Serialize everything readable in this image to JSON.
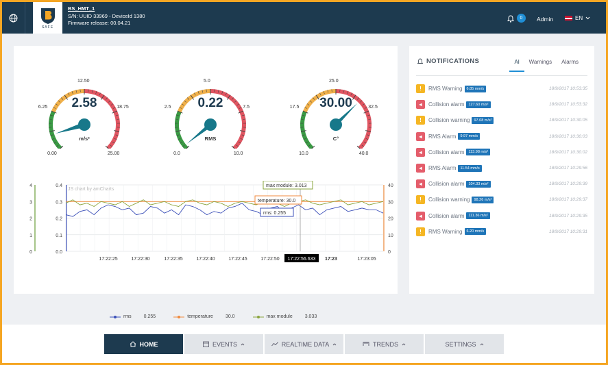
{
  "header": {
    "device_name": "BS_HMT_1",
    "serial": "S/N: UUID 33969 - DeviceId 1380",
    "firmware": "Firmware release: 00.04.21",
    "logo_text": "SAFE",
    "notif_count": "0",
    "user": "Admin",
    "lang": "EN"
  },
  "gauges": [
    {
      "value": "2.58",
      "unit": "m/s²",
      "min": "0.00",
      "t1": "6.25",
      "t2": "12.50",
      "t3": "18.75",
      "max": "25.00",
      "fraction": 0.103
    },
    {
      "value": "0.22",
      "unit": "RMS",
      "min": "0.0",
      "t1": "2.5",
      "t2": "5.0",
      "t3": "7.5",
      "max": "10.0",
      "fraction": 0.022
    },
    {
      "value": "30.00",
      "unit": "C°",
      "min": "10.0",
      "t1": "17.5",
      "t2": "25.0",
      "t3": "32.5",
      "max": "40.0",
      "fraction": 0.667
    }
  ],
  "chart_data": {
    "type": "line",
    "watermark": "JS chart by amCharts",
    "x": [
      "17:22:25",
      "17:22:30",
      "17:22:35",
      "17:22:40",
      "17:22:45",
      "17:22:50",
      "17:22:56.633",
      "17:23",
      "17:23:05"
    ],
    "axes": {
      "left_outer": {
        "ticks": [
          "0",
          "1",
          "2",
          "3",
          "4"
        ]
      },
      "left_inner": {
        "ticks": [
          "0.0",
          "0.1",
          "0.2",
          "0.3",
          "0.4"
        ]
      },
      "right": {
        "ticks": [
          "0",
          "10",
          "20",
          "30",
          "40"
        ]
      }
    },
    "series": [
      {
        "name": "rms",
        "color": "#3b4fb8",
        "values": [
          0.22,
          0.21,
          0.24,
          0.25,
          0.22,
          0.26,
          0.28,
          0.27,
          0.25,
          0.26,
          0.22,
          0.23,
          0.27,
          0.26,
          0.23,
          0.25,
          0.22,
          0.28,
          0.27,
          0.25,
          0.22,
          0.24,
          0.23,
          0.26,
          0.27,
          0.29,
          0.25,
          0.24,
          0.22,
          0.26,
          0.27,
          0.23,
          0.26,
          0.28,
          0.25,
          0.26,
          0.22,
          0.25,
          0.26,
          0.27,
          0.24,
          0.25,
          0.26,
          0.25,
          0.25,
          0.23
        ]
      },
      {
        "name": "temperature",
        "color": "#f08a3c",
        "values": [
          30,
          30,
          30,
          30,
          30,
          30,
          30,
          30,
          30,
          30,
          30,
          30,
          30,
          30,
          30,
          30,
          30,
          30,
          30,
          30,
          30,
          30,
          30,
          30,
          30,
          30,
          30,
          30,
          30,
          30,
          30,
          30,
          30,
          30,
          30,
          30,
          30,
          30,
          30,
          30,
          30,
          30,
          30,
          30,
          30,
          30
        ]
      },
      {
        "name": "max module",
        "color": "#8aa43c",
        "values": [
          2.9,
          3.1,
          2.8,
          2.9,
          2.7,
          3.0,
          2.9,
          2.8,
          3.0,
          2.7,
          2.9,
          3.1,
          2.8,
          2.9,
          3.0,
          2.8,
          2.7,
          3.0,
          3.1,
          2.9,
          2.8,
          3.0,
          2.9,
          2.7,
          2.9,
          3.0,
          2.9,
          2.8,
          3.0,
          3.1,
          2.9,
          2.7,
          2.9,
          3.0,
          3.1,
          2.9,
          2.8,
          2.9,
          3.0,
          3.1,
          2.8,
          2.9,
          3.0,
          2.8,
          2.9,
          3.0
        ]
      }
    ],
    "tooltips": {
      "max": "max module: 3.013",
      "temp": "temperature: 30.0",
      "rms": "rms: 0.255",
      "cursor": "17:22:56.633"
    },
    "legend": [
      {
        "name": "rms",
        "value": "0.255",
        "color": "#3b4fb8"
      },
      {
        "name": "temperature",
        "value": "30.0",
        "color": "#f08a3c"
      },
      {
        "name": "max module",
        "value": "3.033",
        "color": "#8aa43c"
      }
    ]
  },
  "notifications": {
    "title": "NOTIFICATIONS",
    "tabs": [
      "Al",
      "Warnings",
      "Alarms"
    ],
    "items": [
      {
        "type": "warn",
        "text": "RMS Warning",
        "badge": "6.85 mm/s",
        "date": "18/9/2017 10:53:35"
      },
      {
        "type": "alarm",
        "text": "Collision alarm",
        "badge": "127.60 m/s²",
        "date": "18/9/2017 10:53:32"
      },
      {
        "type": "warn",
        "text": "Collision warning",
        "badge": "97.08 m/s²",
        "date": "18/9/2017 10:30:05"
      },
      {
        "type": "alarm",
        "text": "RMS Alarm",
        "badge": "9.97 mm/s",
        "date": "18/9/2017 10:30:03"
      },
      {
        "type": "alarm",
        "text": "Collision alarm",
        "badge": "113.98 m/s²",
        "date": "18/9/2017 10:30:02"
      },
      {
        "type": "alarm",
        "text": "RMS Alarm",
        "badge": "11.54 mm/s",
        "date": "18/9/2017 10:29:56"
      },
      {
        "type": "alarm",
        "text": "Collision alarm",
        "badge": "104.33 m/s²",
        "date": "18/9/2017 10:29:39"
      },
      {
        "type": "warn",
        "text": "Collision warning",
        "badge": "98.26 m/s²",
        "date": "18/9/2017 10:29:37"
      },
      {
        "type": "alarm",
        "text": "Collision alarm",
        "badge": "111.36 m/s²",
        "date": "18/9/2017 10:29:35"
      },
      {
        "type": "warn",
        "text": "RMS Warning",
        "badge": "6.20 mm/s",
        "date": "18/9/2017 10:29:31"
      }
    ]
  },
  "nav": {
    "home": "HOME",
    "events": "EVENTS",
    "realtime": "REALTIME DATA",
    "trends": "TRENDS",
    "settings": "SETTINGS"
  },
  "colors": {
    "primary": "#1d3a4f",
    "accent": "#1f8fd6",
    "warn": "#f5b623",
    "alarm": "#e45d6b",
    "frame": "#f5a623"
  }
}
